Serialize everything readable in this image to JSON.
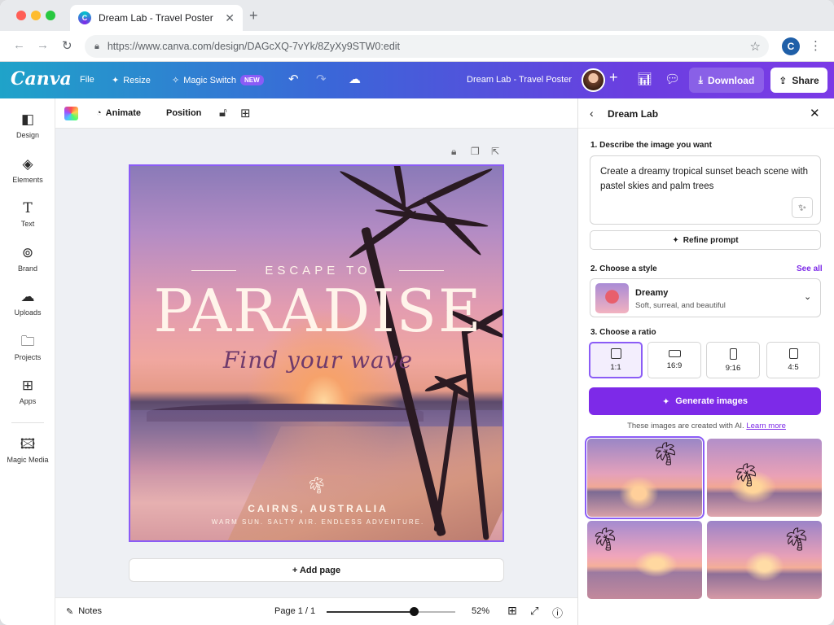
{
  "browser": {
    "tab_title": "Dream Lab - Travel Poster",
    "url": "https://www.canva.com/design/DAGcXQ-7vYk/8ZyXy9STW0:edit",
    "profile_initial": "C"
  },
  "header": {
    "logo": "Canva",
    "file": "File",
    "resize": "Resize",
    "magic_switch": "Magic Switch",
    "new_badge": "NEW",
    "design_title": "Dream Lab - Travel Poster",
    "download": "Download",
    "share": "Share"
  },
  "sidebar": {
    "items": [
      {
        "label": "Design",
        "icon": "design-icon"
      },
      {
        "label": "Elements",
        "icon": "elements-icon"
      },
      {
        "label": "Text",
        "icon": "text-icon"
      },
      {
        "label": "Brand",
        "icon": "brand-icon"
      },
      {
        "label": "Uploads",
        "icon": "upload-icon"
      },
      {
        "label": "Projects",
        "icon": "folder-icon"
      },
      {
        "label": "Apps",
        "icon": "apps-icon"
      },
      {
        "label": "Magic Media",
        "icon": "magic-media-icon"
      }
    ]
  },
  "toolbar": {
    "animate": "Animate",
    "position": "Position"
  },
  "poster": {
    "escape": "ESCAPE TO",
    "paradise": "PARADISE",
    "tagline": "Find your wave",
    "location": "CAIRNS, AUSTRALIA",
    "subline": "WARM SUN. SALTY AIR. ENDLESS ADVENTURE."
  },
  "canvas": {
    "add_page": "+ Add page"
  },
  "bottom": {
    "notes": "Notes",
    "page": "Page 1 / 1",
    "zoom": "52%",
    "zoom_level": 0.52
  },
  "panel": {
    "title": "Dream Lab",
    "step1": "1. Describe the image you want",
    "prompt": "Create a dreamy tropical sunset beach scene with pastel skies and palm trees",
    "refine": "Refine prompt",
    "step2": "2. Choose a style",
    "see_all": "See all",
    "style_name": "Dreamy",
    "style_desc": "Soft, surreal, and beautiful",
    "step3": "3. Choose a ratio",
    "ratios": [
      "1:1",
      "16:9",
      "9:16",
      "4:5"
    ],
    "selected_ratio": "1:1",
    "generate": "Generate images",
    "ai_note": "These images are created with AI.",
    "learn_more": "Learn more"
  },
  "colors": {
    "accent": "#7d2ae8",
    "selection": "#8b5cf6"
  }
}
